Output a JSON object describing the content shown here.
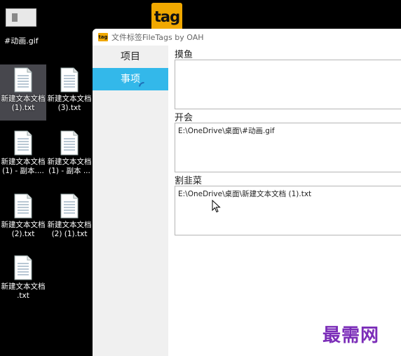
{
  "desktop": {
    "gif_icon": {
      "label": "#动画.gif"
    },
    "tag_logo": {
      "text": "tag"
    },
    "icons": [
      {
        "label": "新建文本文档 (1).txt"
      },
      {
        "label": "新建文本文档 (3).txt"
      },
      {
        "label": "新建文本文档 (1) - 副本...."
      },
      {
        "label": "新建文本文档 (1) - 副本 ..."
      },
      {
        "label": "新建文本文档 (2).txt"
      },
      {
        "label": "新建文本文档 (2) (1).txt"
      },
      {
        "label": "新建文本文档 .txt"
      }
    ]
  },
  "window": {
    "title": "文件标签FileTags by OAH",
    "logo_text": "tag",
    "sidebar": {
      "items": [
        {
          "label": "项目",
          "active": false
        },
        {
          "label": "事项",
          "active": true
        }
      ]
    },
    "groups": [
      {
        "label": "摸鱼",
        "files": []
      },
      {
        "label": "开会",
        "files": [
          "E:\\OneDrive\\桌面\\#动画.gif"
        ]
      },
      {
        "label": "割韭菜",
        "files": [
          "E:\\OneDrive\\桌面\\新建文本文档 (1).txt"
        ]
      }
    ]
  },
  "watermark": "最需网",
  "colors": {
    "accent": "#33b8ea",
    "logo": "#f0a800",
    "watermark": "#7b2db8"
  }
}
